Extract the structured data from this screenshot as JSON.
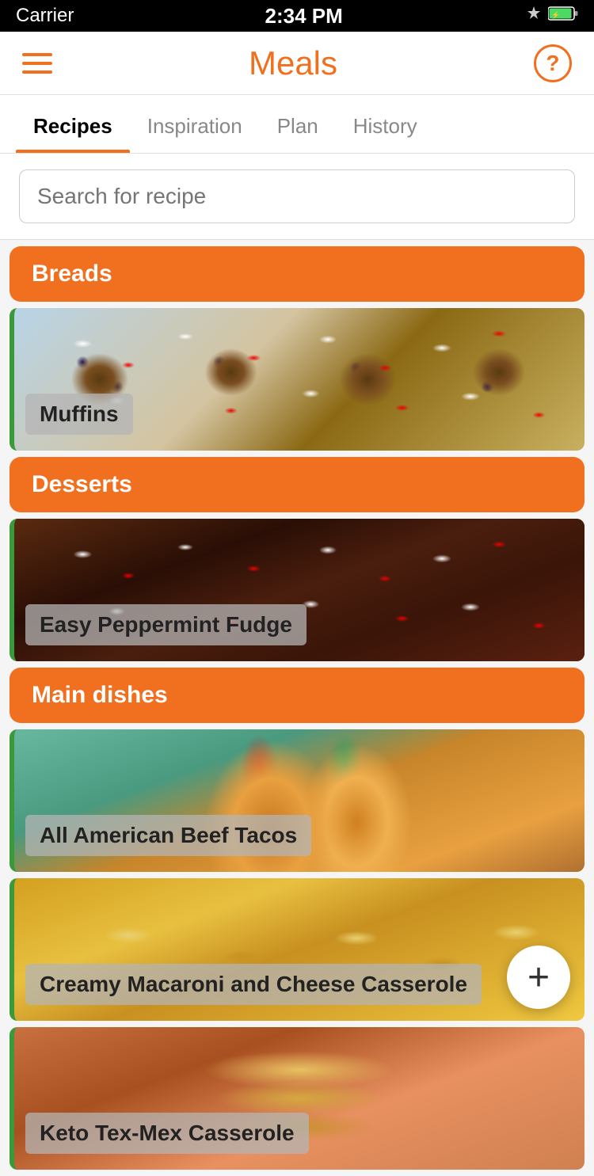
{
  "statusBar": {
    "carrier": "Carrier",
    "time": "2:34 PM"
  },
  "header": {
    "title": "Meals",
    "helpAriaLabel": "Help"
  },
  "tabs": [
    {
      "id": "recipes",
      "label": "Recipes",
      "active": true
    },
    {
      "id": "inspiration",
      "label": "Inspiration",
      "active": false
    },
    {
      "id": "plan",
      "label": "Plan",
      "active": false
    },
    {
      "id": "history",
      "label": "History",
      "active": false
    }
  ],
  "search": {
    "placeholder": "Search for recipe"
  },
  "categories": [
    {
      "id": "breads",
      "label": "Breads",
      "items": [
        {
          "id": "muffins",
          "label": "Muffins",
          "imageClass": "muffins-bg"
        }
      ]
    },
    {
      "id": "desserts",
      "label": "Desserts",
      "items": [
        {
          "id": "peppermint-fudge",
          "label": "Easy Peppermint Fudge",
          "imageClass": "fudge-bg"
        }
      ]
    },
    {
      "id": "main-dishes",
      "label": "Main dishes",
      "items": [
        {
          "id": "beef-tacos",
          "label": "All American Beef Tacos",
          "imageClass": "tacos-bg"
        },
        {
          "id": "mac-cheese",
          "label": "Creamy Macaroni and Cheese Casserole",
          "imageClass": "mac-bg"
        },
        {
          "id": "keto-casserole",
          "label": "Keto Tex-Mex Casserole",
          "imageClass": "keto-bg"
        }
      ]
    }
  ],
  "fab": {
    "label": "+"
  }
}
